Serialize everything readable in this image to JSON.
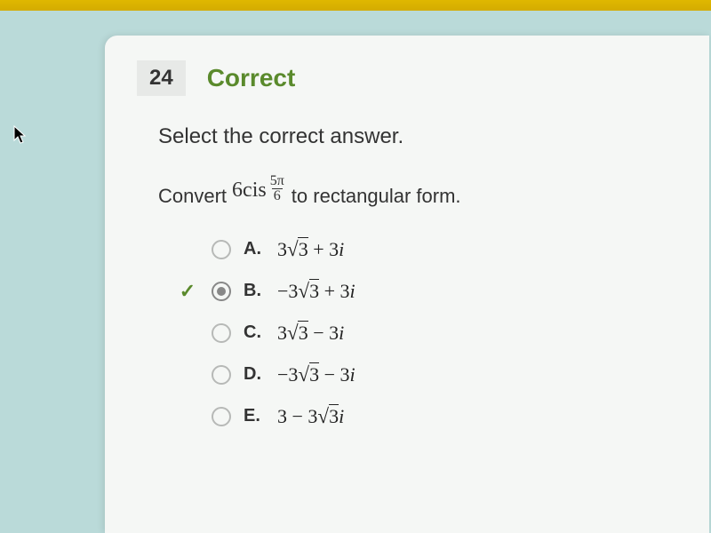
{
  "question": {
    "number": "24",
    "status": "Correct",
    "instruction": "Select the correct answer.",
    "prompt_prefix": "Convert",
    "expr_coef": "6cis",
    "expr_frac_num": "5π",
    "expr_frac_den": "6",
    "prompt_suffix": "to rectangular form."
  },
  "correct_index": 1,
  "options": [
    {
      "label": "A.",
      "text": "3√3 + 3𝑖"
    },
    {
      "label": "B.",
      "text": "−3√3 + 3𝑖"
    },
    {
      "label": "C.",
      "text": "3√3 − 3𝑖"
    },
    {
      "label": "D.",
      "text": "−3√3 − 3𝑖"
    },
    {
      "label": "E.",
      "text": "3 − 3√3𝑖"
    }
  ]
}
